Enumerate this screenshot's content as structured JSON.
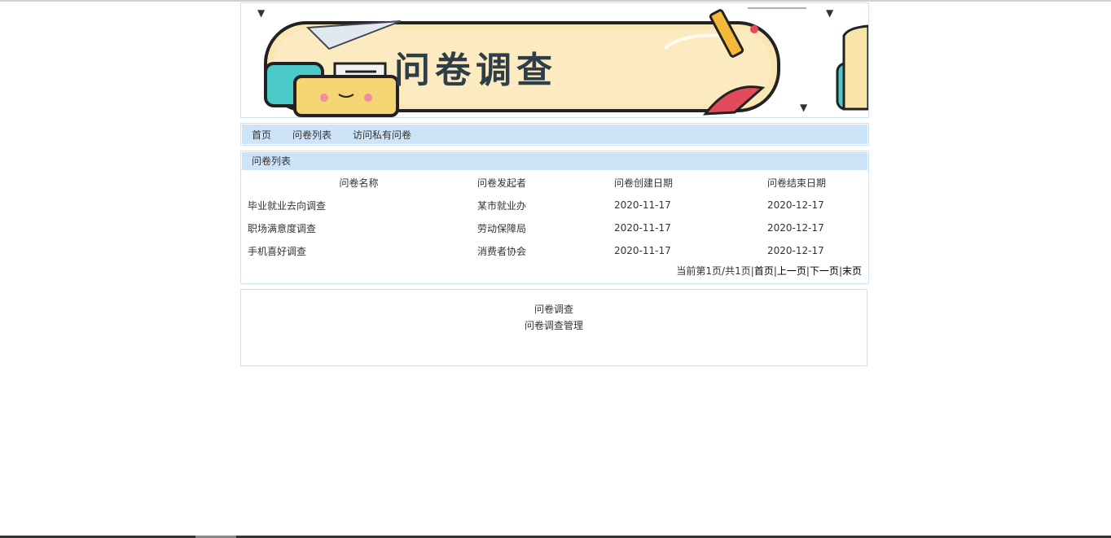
{
  "banner": {
    "title": "问卷调查"
  },
  "nav": {
    "items": [
      "首页",
      "问卷列表",
      "访问私有问卷"
    ]
  },
  "survey_list": {
    "title": "问卷列表",
    "columns": [
      "问卷名称",
      "问卷发起者",
      "问卷创建日期",
      "问卷结束日期"
    ],
    "rows": [
      [
        "毕业就业去向调查",
        "某市就业办",
        "2020-11-17",
        "2020-12-17"
      ],
      [
        "职场满意度调查",
        "劳动保障局",
        "2020-11-17",
        "2020-12-17"
      ],
      [
        "手机喜好调查",
        "消费者协会",
        "2020-11-17",
        "2020-12-17"
      ]
    ],
    "pager": {
      "status": "当前第1页/共1页",
      "first": "首页",
      "prev": "上一页",
      "next": "下一页",
      "last": "末页"
    }
  },
  "footer": {
    "line1": "问卷调查",
    "line2": "问卷调查管理"
  },
  "colors": {
    "accent": "#cde3f7",
    "border": "#cfe3ee"
  }
}
